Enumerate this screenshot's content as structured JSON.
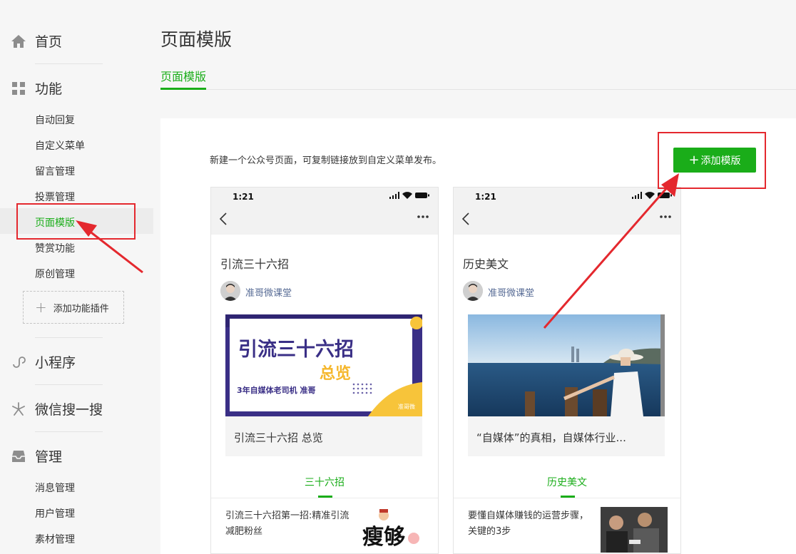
{
  "sidebar": {
    "home": "首页",
    "function": "功能",
    "function_items": [
      "自动回复",
      "自定义菜单",
      "留言管理",
      "投票管理",
      "页面模版",
      "赞赏功能",
      "原创管理"
    ],
    "add_plugin": "添加功能插件",
    "miniprogram": "小程序",
    "search": "微信搜一搜",
    "manage": "管理",
    "manage_items": [
      "消息管理",
      "用户管理",
      "素材管理"
    ]
  },
  "header": {
    "title": "页面模版",
    "tab": "页面模版"
  },
  "content": {
    "description": "新建一个公众号页面，可复制链接放到自定义菜单发布。",
    "add_button": "添加模版",
    "add_plus": "+"
  },
  "cards": [
    {
      "time": "1:21",
      "title": "引流三十六招",
      "author": "准哥微课堂",
      "cover_headline": "引流三十六招",
      "cover_sub": "总览",
      "cover_tagline": "3年自媒体老司机 准哥",
      "cover_logo": "准哥微",
      "caption": "引流三十六招 总览",
      "tab": "三十六招",
      "article": "引流三十六招第一招:精准引流减肥粉丝",
      "thumb_text": "瘦够"
    },
    {
      "time": "1:21",
      "title": "历史美文",
      "author": "准哥微课堂",
      "caption": "“自媒体”的真相，自媒体行业...",
      "tab": "历史美文",
      "article": "要懂自媒体赚钱的运营步骤，关键的3步"
    }
  ],
  "colors": {
    "accent": "#1aad19",
    "annotation": "#e4282e",
    "link": "#576b95"
  }
}
